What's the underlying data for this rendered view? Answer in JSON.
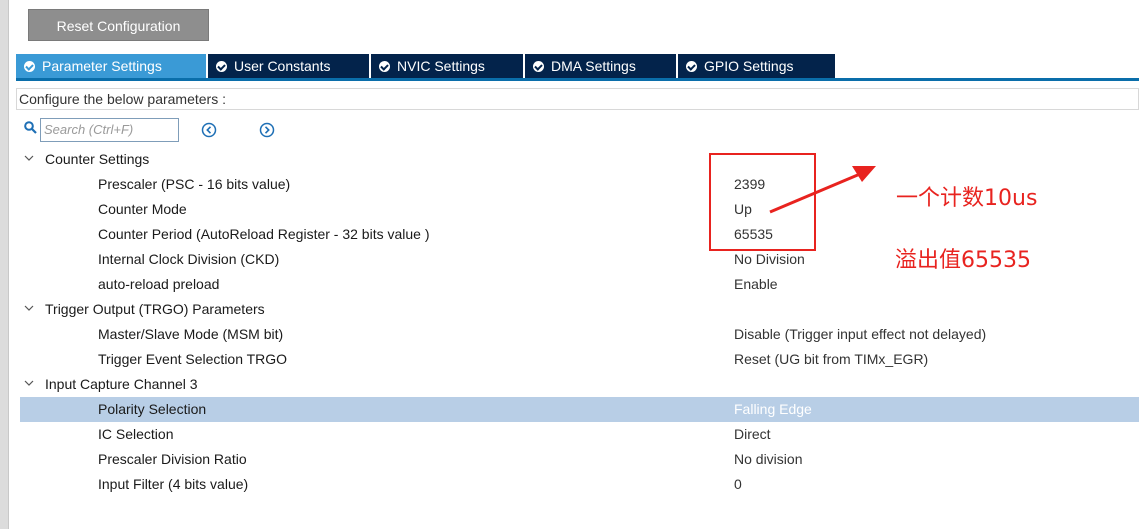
{
  "toolbar": {
    "reset_label": "Reset Configuration"
  },
  "tabs": [
    {
      "label": "Parameter Settings",
      "active": true
    },
    {
      "label": "User Constants"
    },
    {
      "label": "NVIC Settings"
    },
    {
      "label": "DMA Settings"
    },
    {
      "label": "GPIO Settings"
    }
  ],
  "configure_label": "Configure the below parameters :",
  "search": {
    "placeholder": "Search (Ctrl+F)"
  },
  "groups": {
    "counter": {
      "label": "Counter Settings",
      "rows": [
        {
          "label": "Prescaler (PSC - 16 bits value)",
          "value": "2399"
        },
        {
          "label": "Counter Mode",
          "value": "Up"
        },
        {
          "label": "Counter Period (AutoReload Register - 32 bits value )",
          "value": "65535"
        },
        {
          "label": "Internal Clock Division (CKD)",
          "value": "No Division"
        },
        {
          "label": "auto-reload preload",
          "value": "Enable"
        }
      ]
    },
    "trgo": {
      "label": "Trigger Output (TRGO) Parameters",
      "rows": [
        {
          "label": "Master/Slave Mode (MSM bit)",
          "value": "Disable (Trigger input effect not delayed)"
        },
        {
          "label": "Trigger Event Selection TRGO",
          "value": "Reset (UG bit from TIMx_EGR)"
        }
      ]
    },
    "capture": {
      "label": "Input Capture Channel 3",
      "rows": [
        {
          "label": "Polarity Selection",
          "value": "Falling Edge"
        },
        {
          "label": "IC Selection",
          "value": "Direct"
        },
        {
          "label": "Prescaler Division Ratio",
          "value": "No division"
        },
        {
          "label": "Input Filter (4 bits value)",
          "value": "0"
        }
      ]
    }
  },
  "annotations": {
    "line1": "一个计数10us",
    "line2": "溢出值65535"
  },
  "colors": {
    "tab_active": "#3a9ad6",
    "tab_inactive": "#03234b",
    "selection": "#b8cee6",
    "annotation": "#e8231f"
  }
}
